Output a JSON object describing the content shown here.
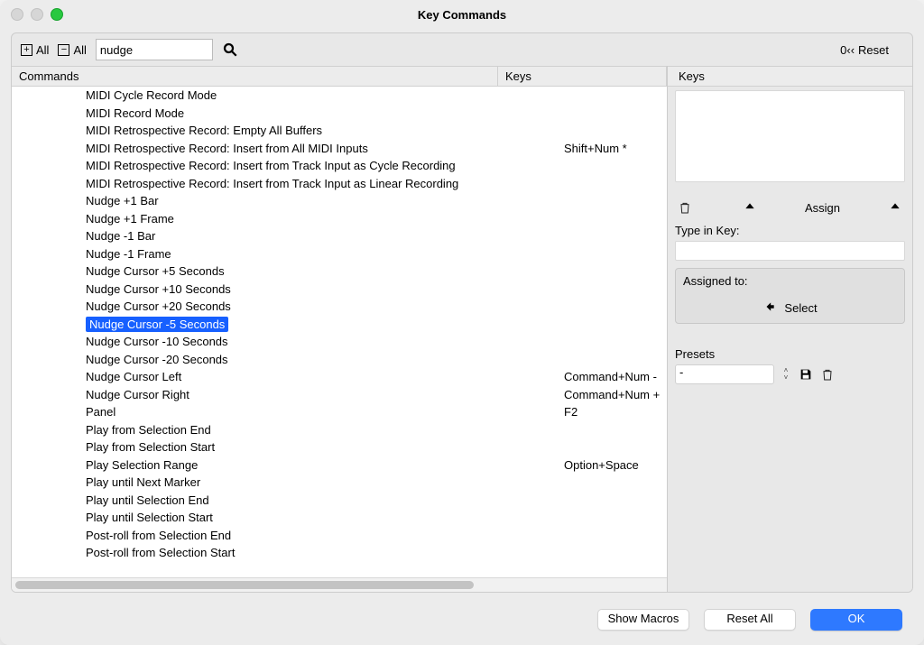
{
  "window": {
    "title": "Key Commands"
  },
  "toolbar": {
    "expand_all": "All",
    "collapse_all": "All",
    "search_value": "nudge",
    "reset_prefix": "0‹‹",
    "reset_label": "Reset"
  },
  "table": {
    "header_commands": "Commands",
    "header_keys": "Keys",
    "rows": [
      {
        "cmd": "MIDI Cycle Record Mode",
        "key": ""
      },
      {
        "cmd": "MIDI Record Mode",
        "key": ""
      },
      {
        "cmd": "MIDI Retrospective Record: Empty All Buffers",
        "key": ""
      },
      {
        "cmd": "MIDI Retrospective Record: Insert from All MIDI Inputs",
        "key": "Shift+Num *"
      },
      {
        "cmd": "MIDI Retrospective Record: Insert from Track Input as Cycle Recording",
        "key": ""
      },
      {
        "cmd": "MIDI Retrospective Record: Insert from Track Input as Linear Recording",
        "key": ""
      },
      {
        "cmd": "Nudge +1 Bar",
        "key": ""
      },
      {
        "cmd": "Nudge +1 Frame",
        "key": ""
      },
      {
        "cmd": "Nudge -1 Bar",
        "key": ""
      },
      {
        "cmd": "Nudge -1 Frame",
        "key": ""
      },
      {
        "cmd": "Nudge Cursor +5 Seconds",
        "key": ""
      },
      {
        "cmd": "Nudge Cursor +10 Seconds",
        "key": ""
      },
      {
        "cmd": "Nudge Cursor +20 Seconds",
        "key": ""
      },
      {
        "cmd": "Nudge Cursor -5 Seconds",
        "key": "",
        "selected": true
      },
      {
        "cmd": "Nudge Cursor -10 Seconds",
        "key": ""
      },
      {
        "cmd": "Nudge Cursor -20 Seconds",
        "key": ""
      },
      {
        "cmd": "Nudge Cursor Left",
        "key": "Command+Num -"
      },
      {
        "cmd": "Nudge Cursor Right",
        "key": "Command+Num +"
      },
      {
        "cmd": "Panel",
        "key": "F2"
      },
      {
        "cmd": "Play from Selection End",
        "key": ""
      },
      {
        "cmd": "Play from Selection Start",
        "key": ""
      },
      {
        "cmd": "Play Selection Range",
        "key": "Option+Space"
      },
      {
        "cmd": "Play until Next Marker",
        "key": ""
      },
      {
        "cmd": "Play until Selection End",
        "key": ""
      },
      {
        "cmd": "Play until Selection Start",
        "key": ""
      },
      {
        "cmd": "Post-roll from Selection End",
        "key": ""
      },
      {
        "cmd": "Post-roll from Selection Start",
        "key": ""
      }
    ]
  },
  "right": {
    "keys_header": "Keys",
    "assign_label": "Assign",
    "type_in_label": "Type in Key:",
    "assigned_to_label": "Assigned to:",
    "select_label": "Select",
    "presets_label": "Presets",
    "preset_value": "-"
  },
  "buttons": {
    "show_macros": "Show Macros",
    "reset_all": "Reset All",
    "ok": "OK"
  }
}
